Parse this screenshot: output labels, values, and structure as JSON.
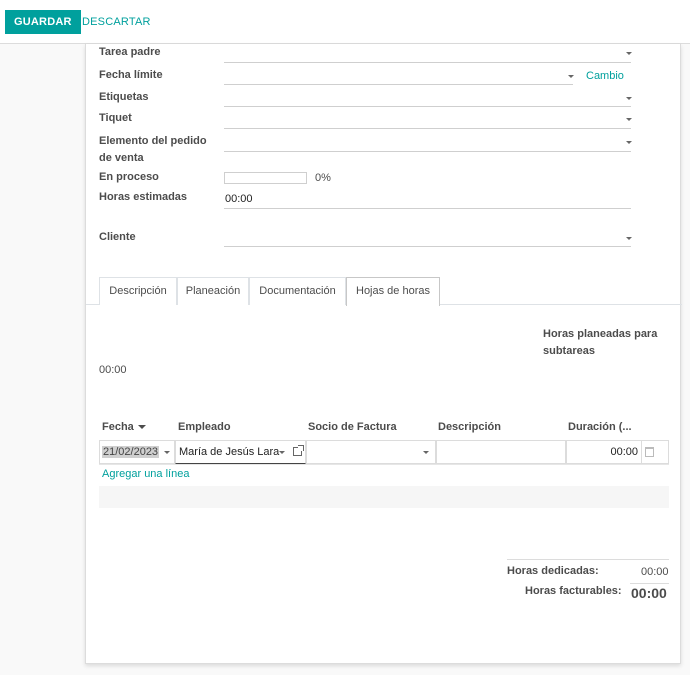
{
  "toolbar": {
    "save_label": "GUARDAR",
    "discard_label": "DESCARTAR"
  },
  "form": {
    "parent_task_label": "Tarea padre",
    "deadline_label": "Fecha límite",
    "deadline_link": "Cambio",
    "tags_label": "Etiquetas",
    "ticket_label": "Tiquet",
    "sale_line_label_1": "Elemento del pedido",
    "sale_line_label_2": "de venta",
    "progress_label": "En proceso",
    "progress_value": "0%",
    "progress_fraction": 0,
    "planned_hours_label": "Horas estimadas",
    "planned_hours_value": "00:00",
    "customer_label": "Cliente"
  },
  "tabs": [
    {
      "label": "Descripción"
    },
    {
      "label": "Planeación"
    },
    {
      "label": "Documentación"
    },
    {
      "label": "Hojas de horas"
    }
  ],
  "timesheets": {
    "subtask_hours_label_1": "Horas planeadas para",
    "subtask_hours_label_2": "subtareas",
    "subtask_hours_value": "00:00",
    "columns": {
      "date": "Fecha",
      "employee": "Empleado",
      "partner": "Socio de Factura",
      "description": "Descripción",
      "duration": "Duración (..."
    },
    "row": {
      "date": "21/02/2023",
      "employee": "María de Jesús Lara",
      "partner": "",
      "description": "",
      "duration": "00:00"
    },
    "add_line": "Agregar una línea"
  },
  "totals": {
    "effective_label": "Horas dedicadas:",
    "effective_value": "00:00",
    "billable_label": "Horas facturables:",
    "billable_value": "00:00"
  },
  "colors": {
    "accent": "#00a09d"
  }
}
